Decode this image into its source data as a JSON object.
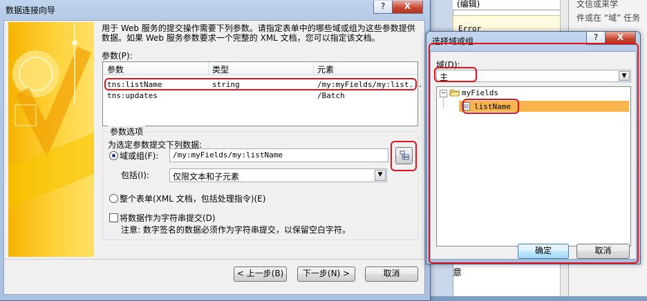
{
  "background": {
    "combo_text": "(编辑)",
    "error_text": "Error",
    "right_lines": [
      "文信或来学",
      "件或在 “域” 任务",
      "",
      "",
      "",
      "",
      "",
      "",
      "",
      "",
      "",
      "",
      "",
      "",
      "",
      "",
      "",
      "",
      "",
      "",
      ""
    ],
    "bottom_text": "意"
  },
  "wizard": {
    "title": "数据连接向导",
    "help_btn": "?",
    "close_btn": "X",
    "description_line1": "用于 Web 服务的提交操作需要下列参数。请指定表单中的哪些域或组为这些参数提供",
    "description_line2": "数据。如果 Web 服务参数要求一个完整的 XML 文档，您可以指定该文档。",
    "params_label": "参数(P):",
    "columns": [
      "参数",
      "类型",
      "元素"
    ],
    "rows": [
      {
        "param": "tns:listName",
        "type": "string",
        "element": "/my:myFields/my:list..."
      },
      {
        "param": "tns:updates",
        "type": "",
        "element": "/Batch"
      }
    ],
    "options_group": "参数选项",
    "submit_label": "为选定参数提交下列数据:",
    "field_or_group_label": "域或组(F):",
    "field_value": "/my:myFields/my:listName",
    "include_label": "包括(I):",
    "include_value": "仅限文本和子元素",
    "whole_form_label": "整个表单(XML 文档，包括处理指令)(E)",
    "as_string_label": "将数据作为字符串提交(D)",
    "note": "注意: 数字签名的数据必须作为字符串提交，以保留空白字符。",
    "back_btn": "< 上一步(B)",
    "next_btn": "下一步(N) >",
    "cancel_btn": "取消"
  },
  "picker": {
    "title": "选择域或组",
    "help_btn": "?",
    "close_btn": "X",
    "field_label": "域(D):",
    "field_value": "主",
    "tree_root": "myFields",
    "tree_expander": "−",
    "tree_child": "listName",
    "ok_btn": "确定",
    "cancel_btn": "取消"
  },
  "colors": {
    "highlight_red": "#e0131b",
    "selection_orange": "#f9b44d",
    "art_yellow": "#ffd23c"
  }
}
